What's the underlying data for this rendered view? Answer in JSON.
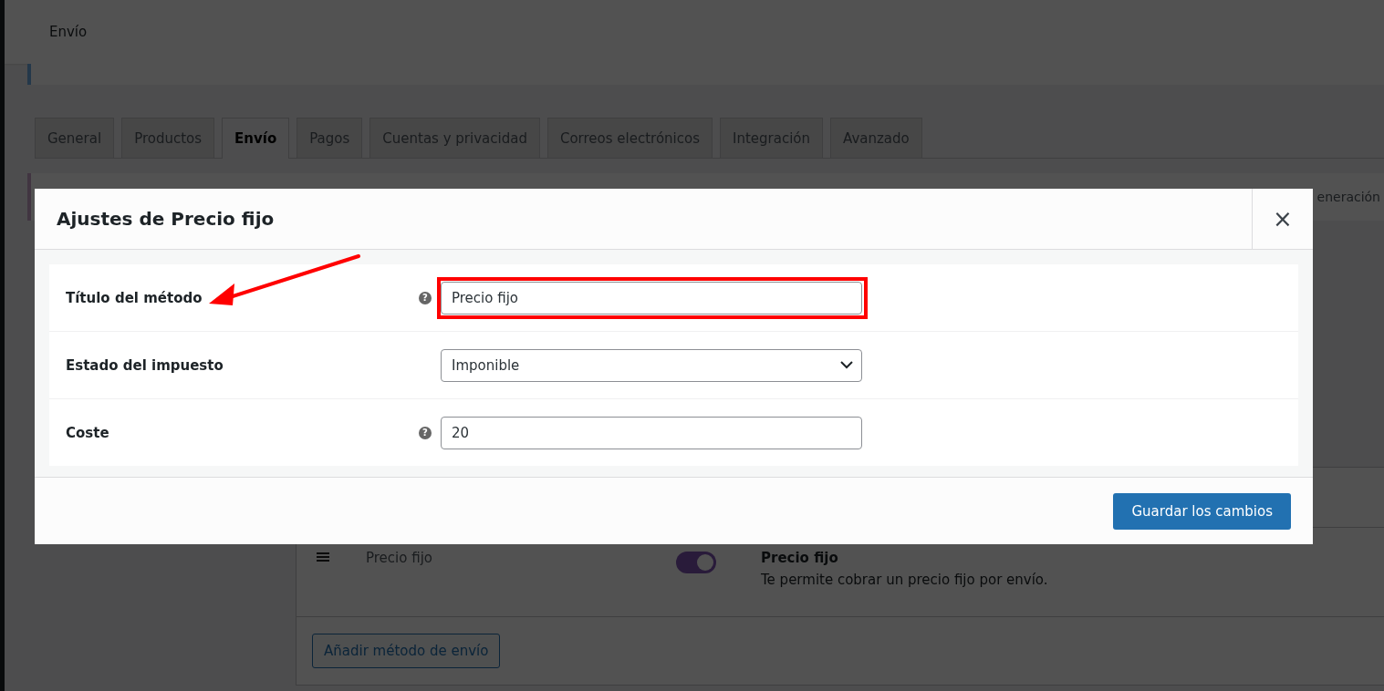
{
  "admin_header": {
    "title": "Envío"
  },
  "tabs": [
    {
      "label": "General",
      "selected": false
    },
    {
      "label": "Productos",
      "selected": false
    },
    {
      "label": "Envío",
      "selected": true
    },
    {
      "label": "Pagos",
      "selected": false
    },
    {
      "label": "Cuentas y privacidad",
      "selected": false
    },
    {
      "label": "Correos electrónicos",
      "selected": false
    },
    {
      "label": "Integración",
      "selected": false
    },
    {
      "label": "Avanzado",
      "selected": false
    }
  ],
  "section_link_fragment": "eneración",
  "shipping_methods": {
    "rows": [
      {
        "title": "Precio fijo",
        "enabled": true,
        "name": "Precio fijo",
        "description": "Te permite cobrar un precio fijo por envío."
      }
    ],
    "add_button": "Añadir método de envío"
  },
  "modal": {
    "title": "Ajustes de Precio fijo",
    "close": "×",
    "fields": [
      {
        "label": "Título del método",
        "kind": "text",
        "help_icon": "?",
        "value": "Precio fijo",
        "highlighted": true
      },
      {
        "label": "Estado del impuesto",
        "kind": "select",
        "value": "Imponible",
        "highlighted": false
      },
      {
        "label": "Coste",
        "kind": "text",
        "help_icon": "?",
        "value": "20",
        "highlighted": false
      }
    ],
    "save_button": "Guardar los cambios"
  }
}
